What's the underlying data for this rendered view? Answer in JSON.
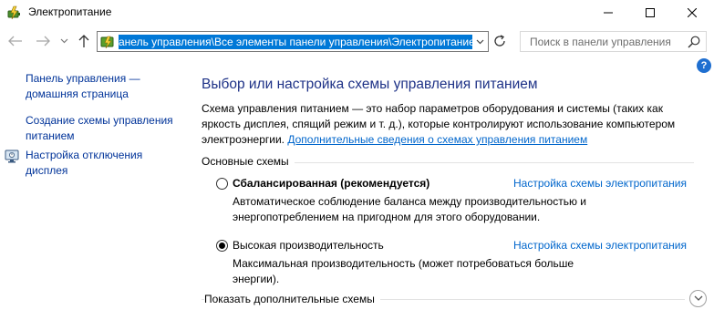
{
  "window": {
    "title": "Электропитание",
    "icon": "power-options-icon"
  },
  "address_bar": {
    "path": "анель управления\\Все элементы панели управления\\Электропитание",
    "icon": "control-panel-icon"
  },
  "search": {
    "placeholder": "Поиск в панели управления"
  },
  "help": {
    "label": "?"
  },
  "sidebar": {
    "home_link": "Панель управления — домашняя страница",
    "create_link": "Создание схемы управления питанием",
    "display_link": "Настройка отключения дисплея",
    "display_icon": "display-power-icon"
  },
  "main": {
    "title": "Выбор или настройка схемы управления питанием",
    "description": "Схема управления питанием — это набор параметров оборудования и системы (таких как яркость дисплея, спящий режим и т. д.), которые контролируют использование компьютером электроэнергии.",
    "description_link": "Дополнительные сведения о схемах управления питанием",
    "section_label": "Основные схемы",
    "plans": [
      {
        "name": "Сбалансированная (рекомендуется)",
        "selected": false,
        "link": "Настройка схемы электропитания",
        "description": "Автоматическое соблюдение баланса между производительностью и энергопотреблением на пригодном для этого оборудовании."
      },
      {
        "name": "Высокая производительность",
        "selected": true,
        "link": "Настройка схемы электропитания",
        "description": "Максимальная производительность (может потребоваться больше энергии)."
      }
    ],
    "show_more": "Показать дополнительные схемы"
  },
  "colors": {
    "title_blue": "#1e3287",
    "link_blue": "#0066cc",
    "side_link": "#003399",
    "selection": "#0078d7"
  }
}
